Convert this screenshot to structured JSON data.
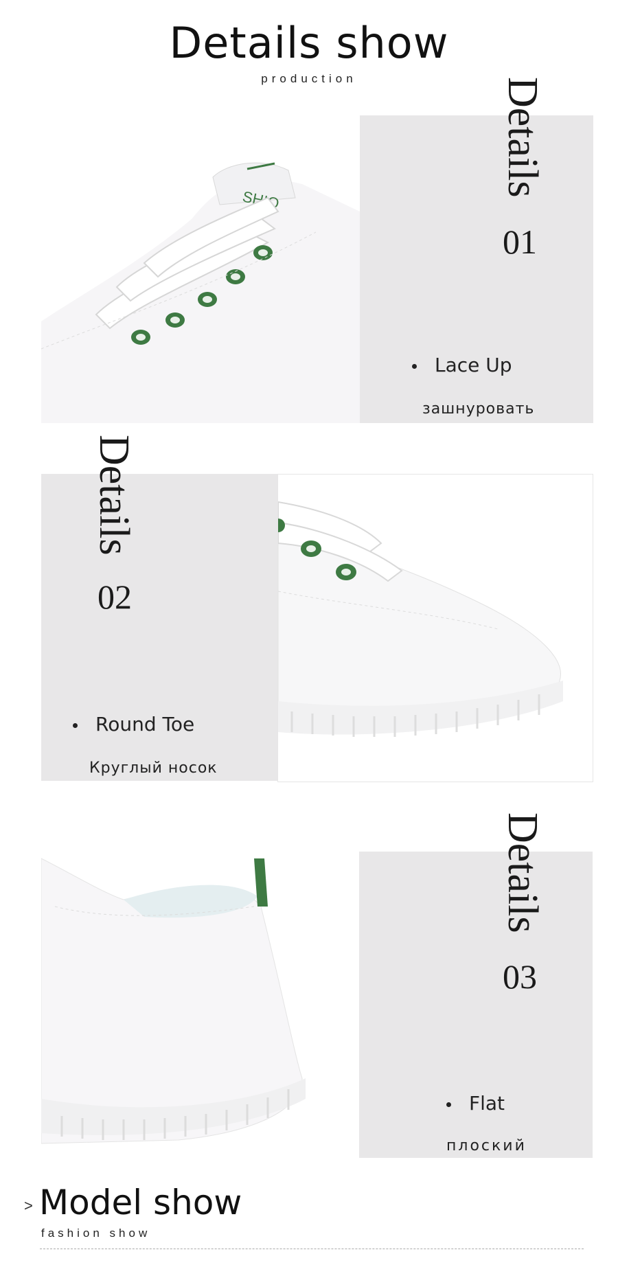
{
  "header": {
    "title": "Details show",
    "subtitle": "production"
  },
  "details": [
    {
      "label": "Details",
      "number": "01",
      "feature": "Lace Up",
      "feature_ru": "зашнуровать"
    },
    {
      "label": "Details",
      "number": "02",
      "feature": "Round Toe",
      "feature_ru": "Круглый носок"
    },
    {
      "label": "Details",
      "number": "03",
      "feature": "Flat",
      "feature_ru": "плоский"
    }
  ],
  "model_section": {
    "arrow": ">",
    "title": "Model show",
    "subtitle": "fashion show"
  },
  "colors": {
    "panel": "#e8e7e8",
    "accent_green": "#3e7a43",
    "text": "#111111"
  }
}
